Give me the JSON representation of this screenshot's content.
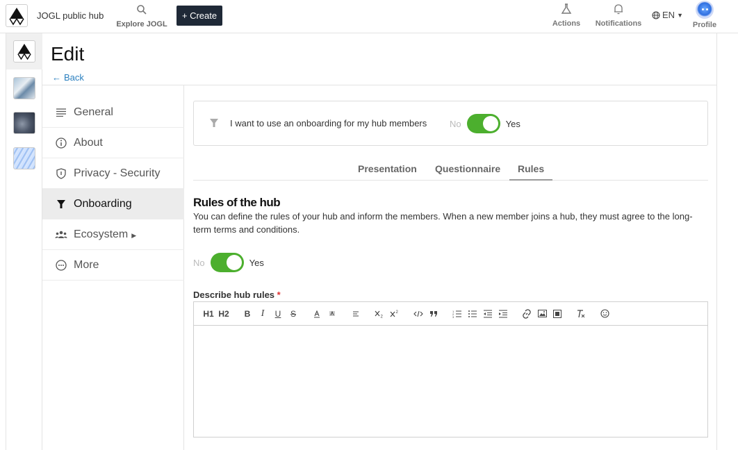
{
  "topbar": {
    "hub_name": "JOGL public hub",
    "explore_label": "Explore JOGL",
    "create_label": "+ Create",
    "actions_label": "Actions",
    "notifications_label": "Notifications",
    "language": "EN",
    "profile_label": "Profile"
  },
  "page": {
    "title": "Edit",
    "back_label": "Back"
  },
  "menu": {
    "items": [
      {
        "label": "General",
        "icon": "lines-icon"
      },
      {
        "label": "About",
        "icon": "info-icon"
      },
      {
        "label": "Privacy - Security",
        "icon": "shield-icon"
      },
      {
        "label": "Onboarding",
        "icon": "filter-icon",
        "active": true
      },
      {
        "label": "Ecosystem",
        "icon": "people-icon",
        "expandable": true
      },
      {
        "label": "More",
        "icon": "more-icon"
      }
    ]
  },
  "onboarding": {
    "question": "I want to use an onboarding for my hub members",
    "no_label": "No",
    "yes_label": "Yes",
    "enabled": true
  },
  "tabs": [
    "Presentation",
    "Questionnaire",
    "Rules"
  ],
  "active_tab": "Rules",
  "rules": {
    "title": "Rules of the hub",
    "description": "You can define the rules of your hub and inform the members. When a new member joins a hub, they must agree to the long-term terms and conditions.",
    "no_label": "No",
    "yes_label": "Yes",
    "enabled": true,
    "field_label": "Describe hub rules",
    "required_mark": "*"
  },
  "editor_toolbar": {
    "h1": "H1",
    "h2": "H2",
    "bold": "B",
    "italic": "I",
    "underline": "U",
    "strike": "S"
  },
  "colors": {
    "accent_green": "#4caf2e",
    "create_bg": "#1f2937",
    "link_blue": "#2a7fbf"
  }
}
